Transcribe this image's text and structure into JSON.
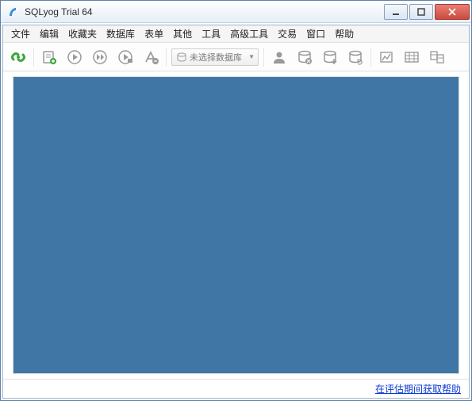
{
  "titlebar": {
    "title": "SQLyog Trial 64"
  },
  "menu": {
    "items": [
      "文件",
      "编辑",
      "收藏夹",
      "数据库",
      "表单",
      "其他",
      "工具",
      "高级工具",
      "交易",
      "窗口",
      "帮助"
    ]
  },
  "toolbar": {
    "db_placeholder": "未选择数据库"
  },
  "statusbar": {
    "trial_link": "在评估期间获取帮助"
  }
}
